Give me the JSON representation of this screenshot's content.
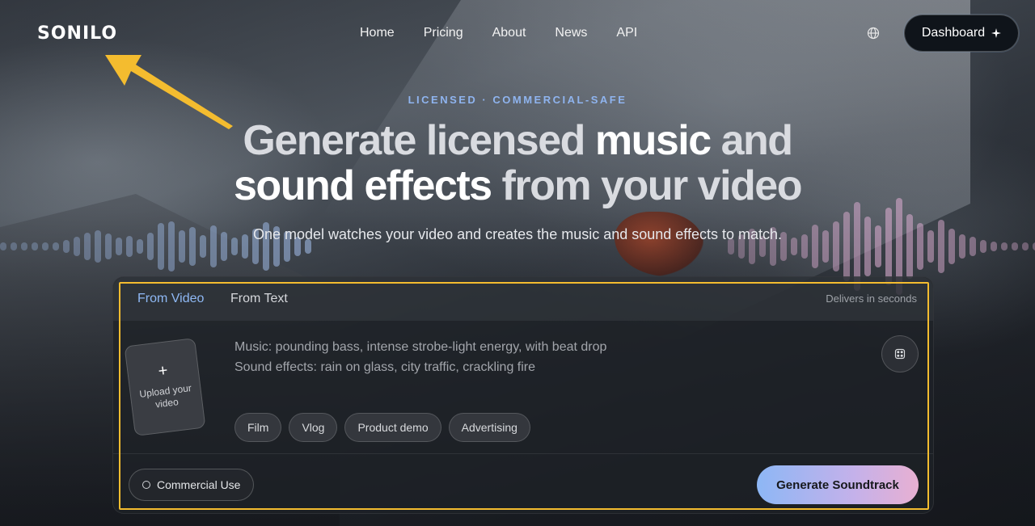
{
  "brand": {
    "logo": "SONILO"
  },
  "nav": {
    "items": [
      "Home",
      "Pricing",
      "About",
      "News",
      "API"
    ]
  },
  "header": {
    "globe_icon": "globe-icon",
    "dashboard_label": "Dashboard",
    "dashboard_icon": "sparkle-icon"
  },
  "hero": {
    "eyebrow": "LICENSED · COMMERCIAL-SAFE",
    "headline_1a": "Generate licensed ",
    "headline_1b": "music",
    "headline_1c": " and",
    "headline_2a": "sound effects",
    "headline_2b": " from your video",
    "subtitle": "One model watches your video and creates the music and sound effects to match."
  },
  "card": {
    "tabs": [
      "From Video",
      "From Text"
    ],
    "active_tab": "From Video",
    "delivers": "Delivers in seconds",
    "upload_plus": "+",
    "upload_label": "Upload your video",
    "prompt_line1": "Music: pounding bass, intense strobe-light energy, with beat drop",
    "prompt_line2": "Sound effects: rain on glass, city traffic, crackling fire",
    "dice_icon": "dice-icon",
    "chips": [
      "Film",
      "Vlog",
      "Product demo",
      "Advertising"
    ],
    "commercial_label": "Commercial Use",
    "generate_label": "Generate Soundtrack"
  },
  "colors": {
    "accent_blue": "#8fb8f5",
    "highlight": "#f4bc2f",
    "generate_gradient_start": "#8db7f5",
    "generate_gradient_end": "#e8b0d2"
  }
}
